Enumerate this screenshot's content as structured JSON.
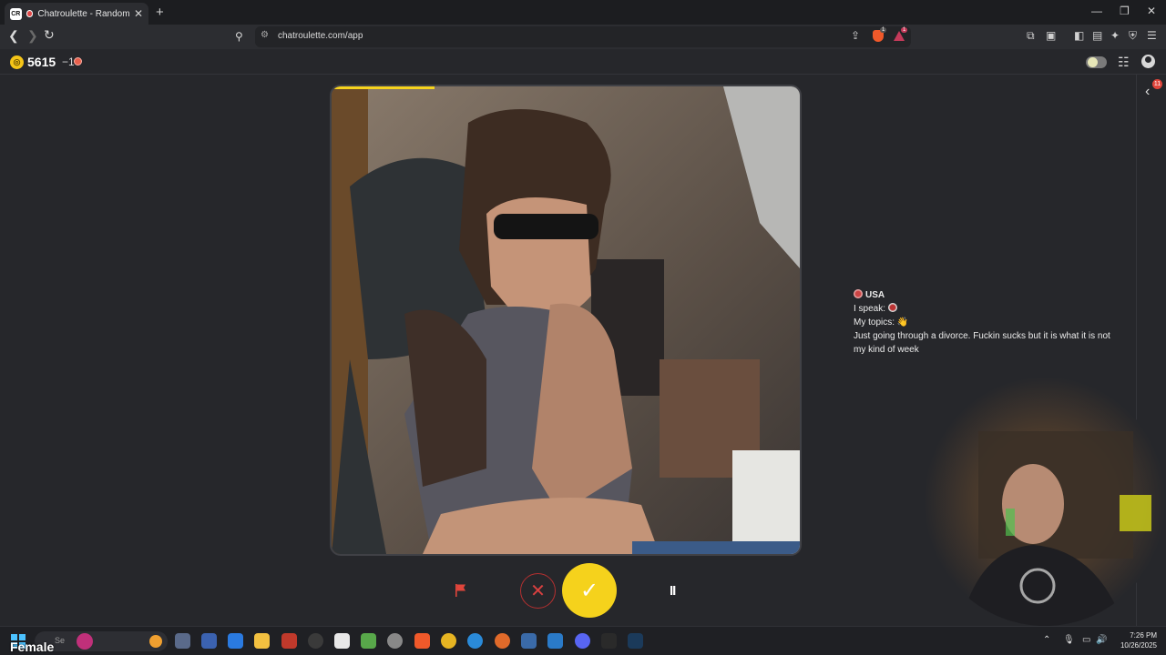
{
  "browser": {
    "tab_title": "Chatroulette - Random video chat",
    "tab_favicon_text": "CR",
    "url": "chatroulette.com/app",
    "new_tab_symbol": "+",
    "window_controls": [
      "—",
      "❐",
      "✕"
    ],
    "extension_badges": [
      "1",
      "1"
    ]
  },
  "app": {
    "coins": "5615",
    "coin_delta": "−1",
    "notification_count": "11",
    "partner": {
      "country": "USA",
      "speaks_label": "I speak:",
      "topics_label": "My topics:",
      "topics_emoji": "👋",
      "bio": "Just going through a divorce. Fuckin sucks but it is what it is not my kind of week"
    },
    "progress_fraction": 0.22,
    "controls": {
      "skip_symbol": "✕",
      "accept_symbol": "✓",
      "pause_symbol": "II"
    }
  },
  "taskbar": {
    "search_text": "Se",
    "overlay_label": "Female",
    "time": "7:26 PM",
    "date": "10/26/2025"
  },
  "colors": {
    "accent": "#f5d21c",
    "skip": "#d84040",
    "background": "#26272b"
  }
}
